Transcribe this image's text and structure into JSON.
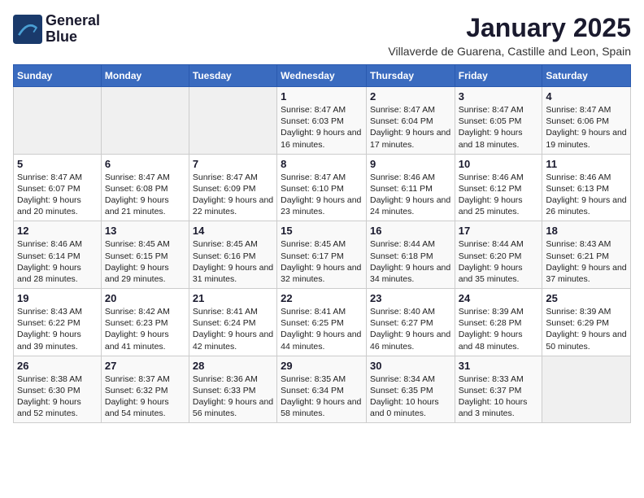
{
  "header": {
    "logo_line1": "General",
    "logo_line2": "Blue",
    "month_year": "January 2025",
    "location": "Villaverde de Guarena, Castille and Leon, Spain"
  },
  "weekdays": [
    "Sunday",
    "Monday",
    "Tuesday",
    "Wednesday",
    "Thursday",
    "Friday",
    "Saturday"
  ],
  "weeks": [
    [
      {
        "day": "",
        "content": ""
      },
      {
        "day": "",
        "content": ""
      },
      {
        "day": "",
        "content": ""
      },
      {
        "day": "1",
        "content": "Sunrise: 8:47 AM\nSunset: 6:03 PM\nDaylight: 9 hours and 16 minutes."
      },
      {
        "day": "2",
        "content": "Sunrise: 8:47 AM\nSunset: 6:04 PM\nDaylight: 9 hours and 17 minutes."
      },
      {
        "day": "3",
        "content": "Sunrise: 8:47 AM\nSunset: 6:05 PM\nDaylight: 9 hours and 18 minutes."
      },
      {
        "day": "4",
        "content": "Sunrise: 8:47 AM\nSunset: 6:06 PM\nDaylight: 9 hours and 19 minutes."
      }
    ],
    [
      {
        "day": "5",
        "content": "Sunrise: 8:47 AM\nSunset: 6:07 PM\nDaylight: 9 hours and 20 minutes."
      },
      {
        "day": "6",
        "content": "Sunrise: 8:47 AM\nSunset: 6:08 PM\nDaylight: 9 hours and 21 minutes."
      },
      {
        "day": "7",
        "content": "Sunrise: 8:47 AM\nSunset: 6:09 PM\nDaylight: 9 hours and 22 minutes."
      },
      {
        "day": "8",
        "content": "Sunrise: 8:47 AM\nSunset: 6:10 PM\nDaylight: 9 hours and 23 minutes."
      },
      {
        "day": "9",
        "content": "Sunrise: 8:46 AM\nSunset: 6:11 PM\nDaylight: 9 hours and 24 minutes."
      },
      {
        "day": "10",
        "content": "Sunrise: 8:46 AM\nSunset: 6:12 PM\nDaylight: 9 hours and 25 minutes."
      },
      {
        "day": "11",
        "content": "Sunrise: 8:46 AM\nSunset: 6:13 PM\nDaylight: 9 hours and 26 minutes."
      }
    ],
    [
      {
        "day": "12",
        "content": "Sunrise: 8:46 AM\nSunset: 6:14 PM\nDaylight: 9 hours and 28 minutes."
      },
      {
        "day": "13",
        "content": "Sunrise: 8:45 AM\nSunset: 6:15 PM\nDaylight: 9 hours and 29 minutes."
      },
      {
        "day": "14",
        "content": "Sunrise: 8:45 AM\nSunset: 6:16 PM\nDaylight: 9 hours and 31 minutes."
      },
      {
        "day": "15",
        "content": "Sunrise: 8:45 AM\nSunset: 6:17 PM\nDaylight: 9 hours and 32 minutes."
      },
      {
        "day": "16",
        "content": "Sunrise: 8:44 AM\nSunset: 6:18 PM\nDaylight: 9 hours and 34 minutes."
      },
      {
        "day": "17",
        "content": "Sunrise: 8:44 AM\nSunset: 6:20 PM\nDaylight: 9 hours and 35 minutes."
      },
      {
        "day": "18",
        "content": "Sunrise: 8:43 AM\nSunset: 6:21 PM\nDaylight: 9 hours and 37 minutes."
      }
    ],
    [
      {
        "day": "19",
        "content": "Sunrise: 8:43 AM\nSunset: 6:22 PM\nDaylight: 9 hours and 39 minutes."
      },
      {
        "day": "20",
        "content": "Sunrise: 8:42 AM\nSunset: 6:23 PM\nDaylight: 9 hours and 41 minutes."
      },
      {
        "day": "21",
        "content": "Sunrise: 8:41 AM\nSunset: 6:24 PM\nDaylight: 9 hours and 42 minutes."
      },
      {
        "day": "22",
        "content": "Sunrise: 8:41 AM\nSunset: 6:25 PM\nDaylight: 9 hours and 44 minutes."
      },
      {
        "day": "23",
        "content": "Sunrise: 8:40 AM\nSunset: 6:27 PM\nDaylight: 9 hours and 46 minutes."
      },
      {
        "day": "24",
        "content": "Sunrise: 8:39 AM\nSunset: 6:28 PM\nDaylight: 9 hours and 48 minutes."
      },
      {
        "day": "25",
        "content": "Sunrise: 8:39 AM\nSunset: 6:29 PM\nDaylight: 9 hours and 50 minutes."
      }
    ],
    [
      {
        "day": "26",
        "content": "Sunrise: 8:38 AM\nSunset: 6:30 PM\nDaylight: 9 hours and 52 minutes."
      },
      {
        "day": "27",
        "content": "Sunrise: 8:37 AM\nSunset: 6:32 PM\nDaylight: 9 hours and 54 minutes."
      },
      {
        "day": "28",
        "content": "Sunrise: 8:36 AM\nSunset: 6:33 PM\nDaylight: 9 hours and 56 minutes."
      },
      {
        "day": "29",
        "content": "Sunrise: 8:35 AM\nSunset: 6:34 PM\nDaylight: 9 hours and 58 minutes."
      },
      {
        "day": "30",
        "content": "Sunrise: 8:34 AM\nSunset: 6:35 PM\nDaylight: 10 hours and 0 minutes."
      },
      {
        "day": "31",
        "content": "Sunrise: 8:33 AM\nSunset: 6:37 PM\nDaylight: 10 hours and 3 minutes."
      },
      {
        "day": "",
        "content": ""
      }
    ]
  ]
}
